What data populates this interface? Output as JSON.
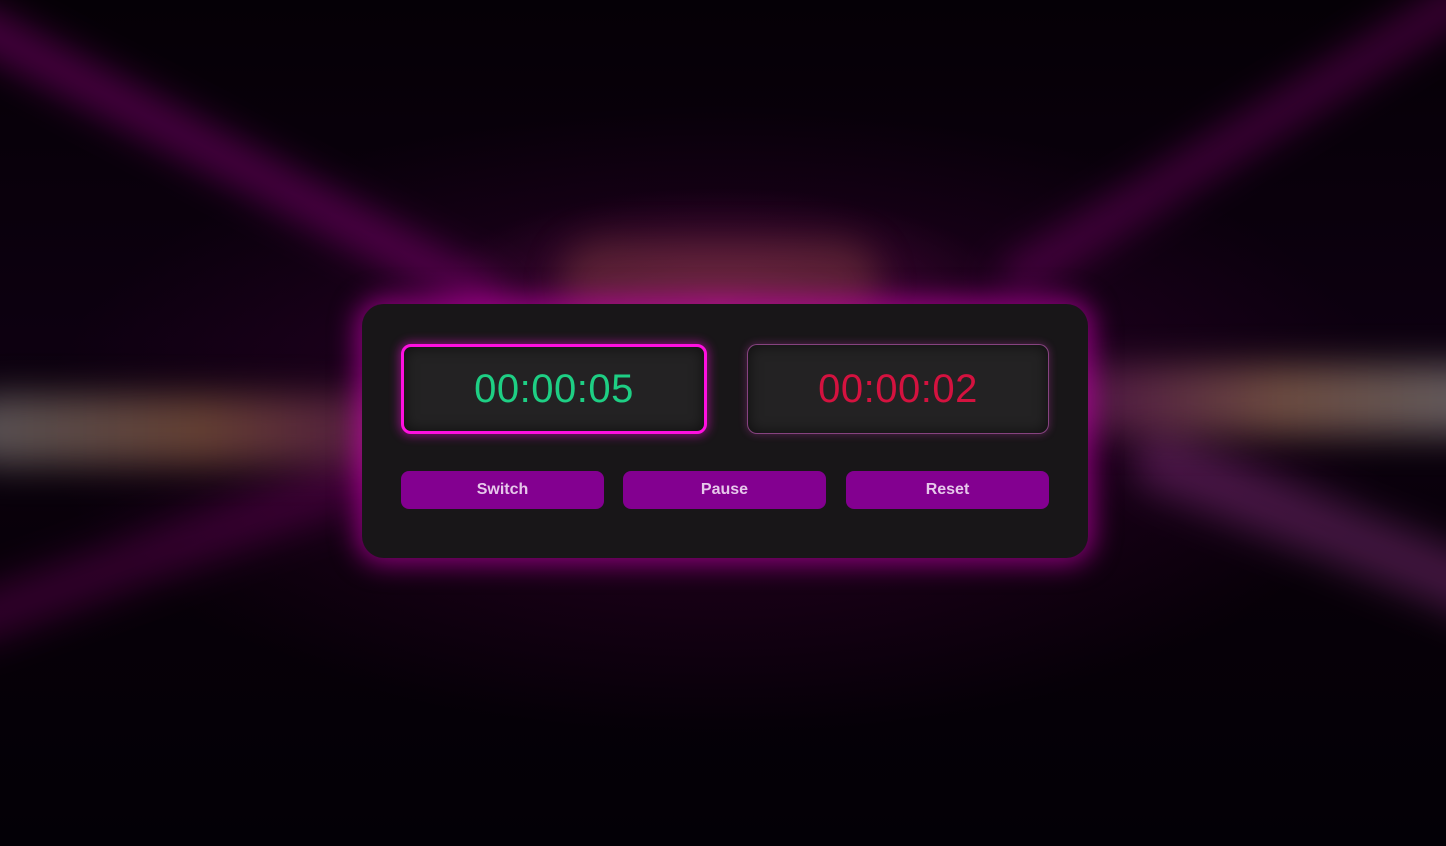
{
  "timers": {
    "player_one": {
      "value": "00:00:05",
      "color": "#1ecf84",
      "active": true
    },
    "player_two": {
      "value": "00:00:02",
      "color": "#d4123f",
      "active": false
    }
  },
  "controls": {
    "switch_label": "Switch",
    "pause_label": "Pause",
    "reset_label": "Reset"
  },
  "theme": {
    "accent": "#ff10e0",
    "button_bg": "#830090",
    "panel_bg": "#181618"
  }
}
